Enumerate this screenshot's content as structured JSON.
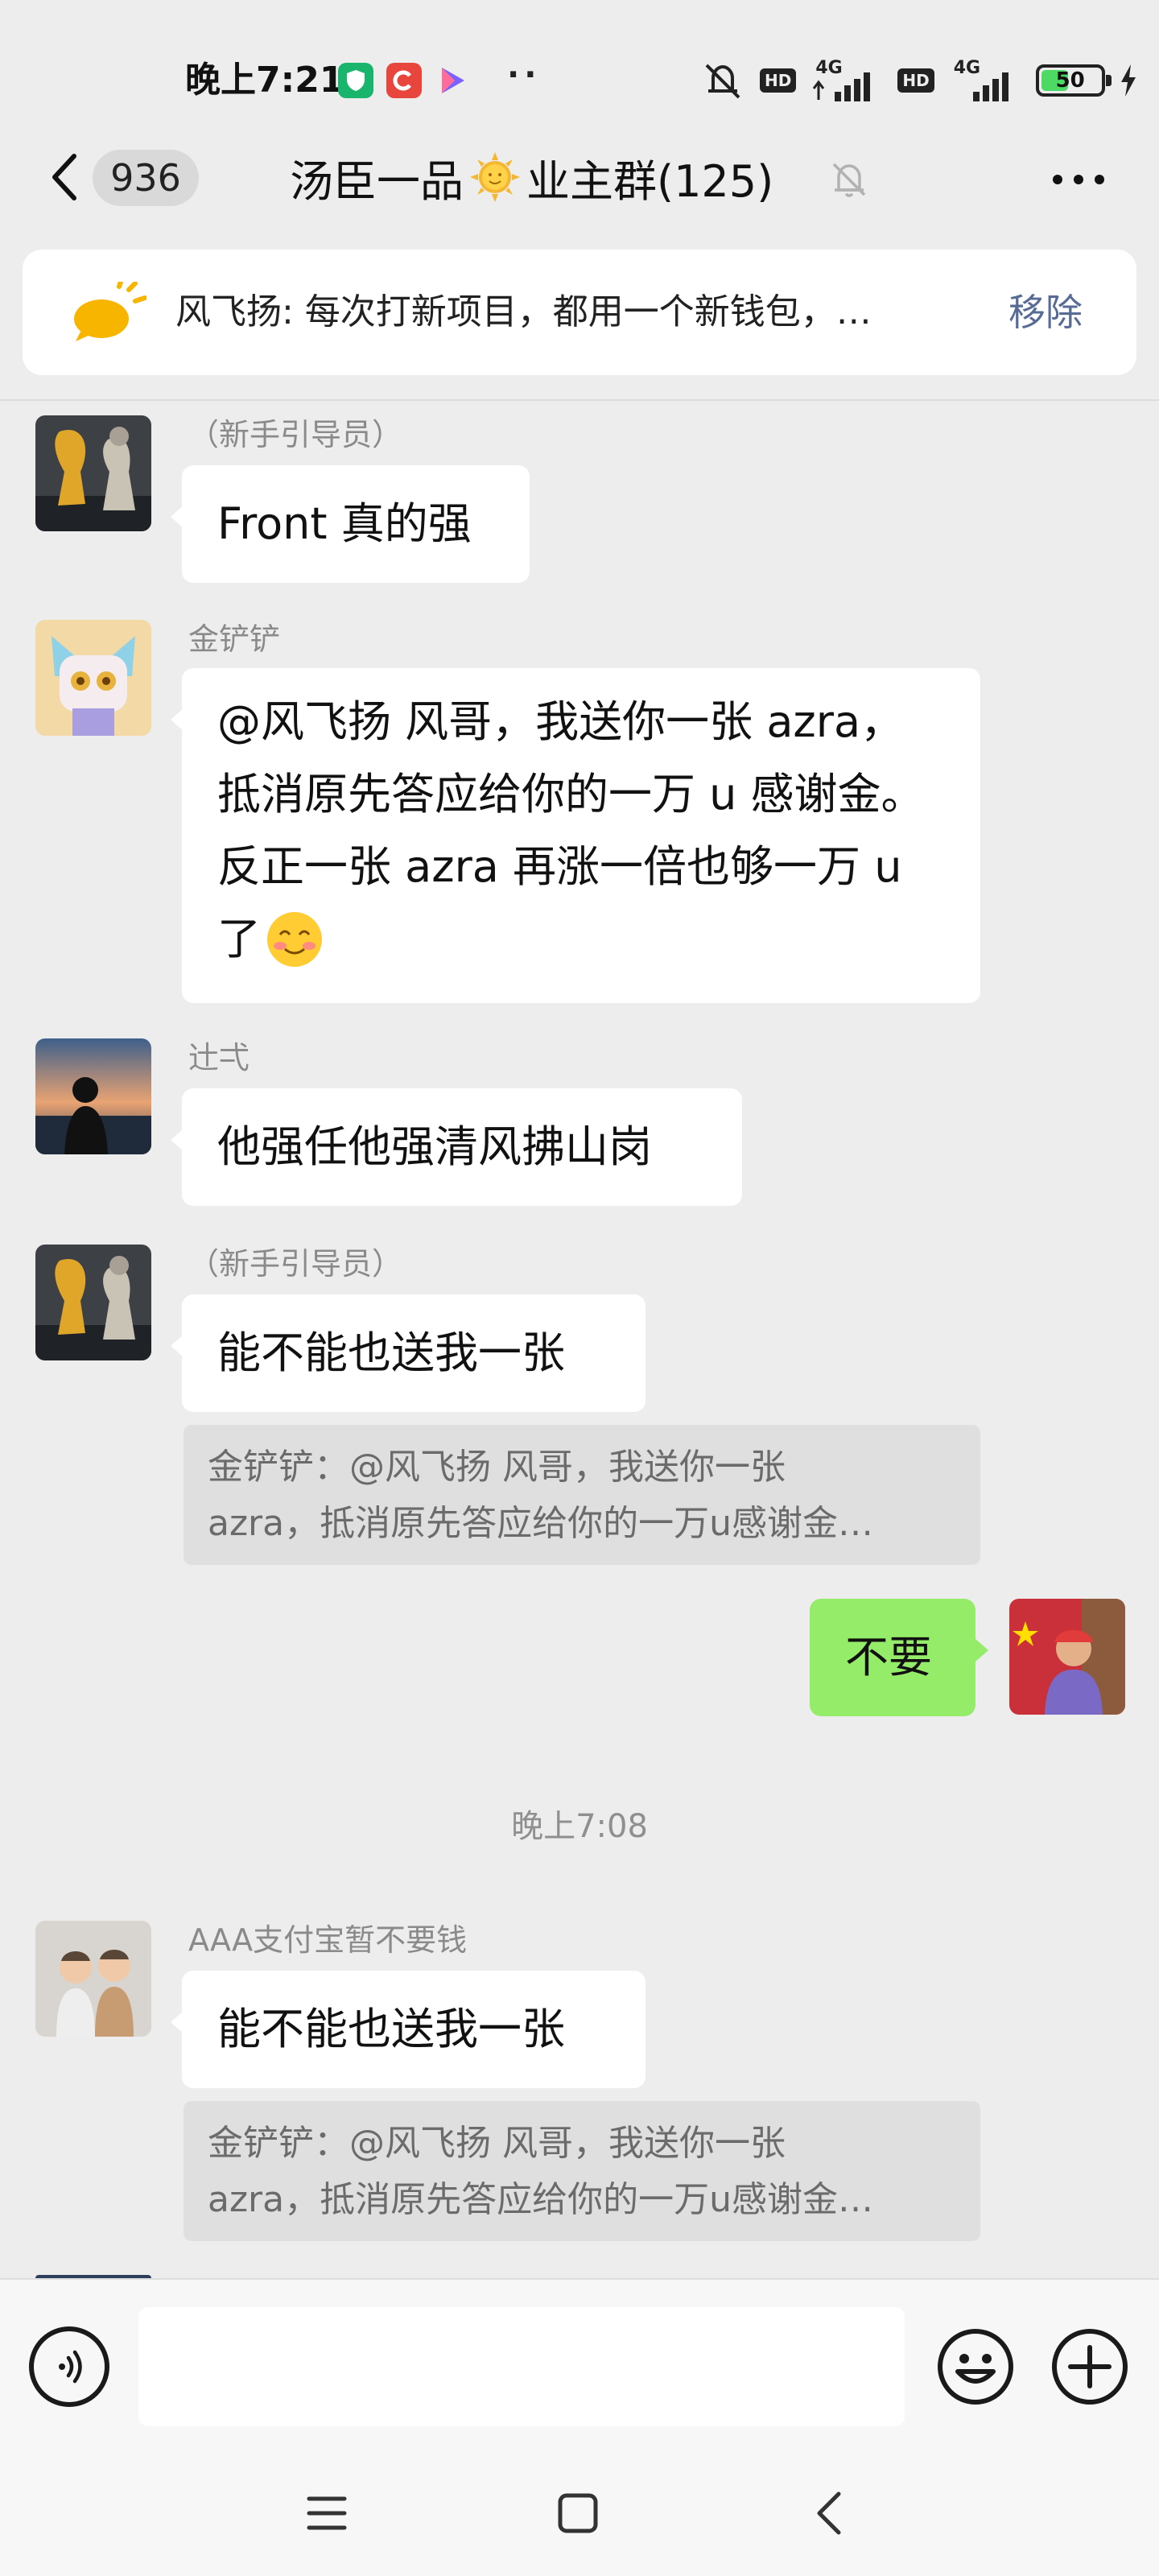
{
  "status_bar": {
    "time": "晚上7:21",
    "more_dots": "··",
    "network_label": "4G",
    "hd_label": "HD",
    "battery_level": "50",
    "battery_percent": 50
  },
  "header": {
    "unread_count": "936",
    "title_before_icon": "汤臣一品",
    "title_after_icon": "业主群(125)"
  },
  "pinned": {
    "text": "风飞扬: 每次打新项目，都用一个新钱包，…",
    "remove_label": "移除"
  },
  "messages": [
    {
      "sender": "（新手引导员）",
      "text": "Front 真的强"
    },
    {
      "sender": "金铲铲",
      "lines": [
        "@风飞扬  风哥，我送你一张 azra，",
        "抵消原先答应给你的一万 u 感谢金。",
        "反正一张 azra 再涨一倍也够一万 u",
        "了"
      ]
    },
    {
      "sender": "辻弌",
      "text": "他强任他强清风拂山岗"
    },
    {
      "sender": "（新手引导员）",
      "text": "能不能也送我一张",
      "quote": [
        "金铲铲：@风飞扬 风哥，我送你一张",
        "azra，抵消原先答应给你的一万u感谢金…"
      ]
    },
    {
      "sender": "",
      "text": "不要",
      "self": true
    },
    {
      "sender": "AAA支付宝暂不要钱",
      "text": "能不能也送我一张",
      "quote": [
        "金铲铲：@风飞扬 风哥，我送你一张",
        "azra，抵消原先答应给你的一万u感谢金…"
      ]
    }
  ],
  "timestamp": "晚上7:08",
  "input": {
    "placeholder": ""
  },
  "colors": {
    "background": "#ededed",
    "self_bubble": "#95ec69",
    "link_blue": "#576b95"
  }
}
